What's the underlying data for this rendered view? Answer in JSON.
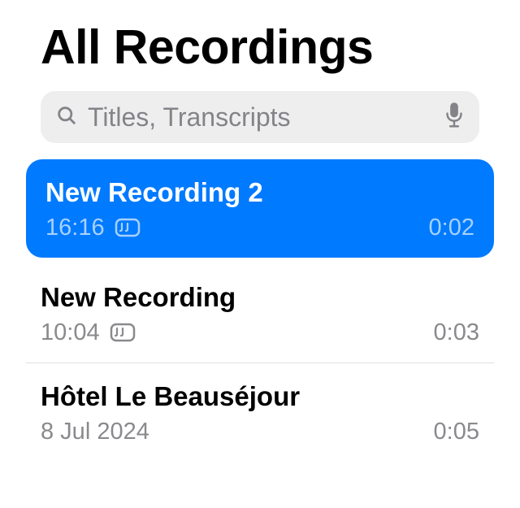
{
  "header": {
    "title": "All Recordings"
  },
  "search": {
    "placeholder": "Titles, Transcripts",
    "value": ""
  },
  "recordings": [
    {
      "title": "New Recording 2",
      "time": "16:16",
      "duration": "0:02",
      "selected": true,
      "hasTranscript": true
    },
    {
      "title": "New Recording",
      "time": "10:04",
      "duration": "0:03",
      "selected": false,
      "hasTranscript": true
    },
    {
      "title": "Hôtel Le Beauséjour",
      "time": "8 Jul 2024",
      "duration": "0:05",
      "selected": false,
      "hasTranscript": false
    }
  ]
}
